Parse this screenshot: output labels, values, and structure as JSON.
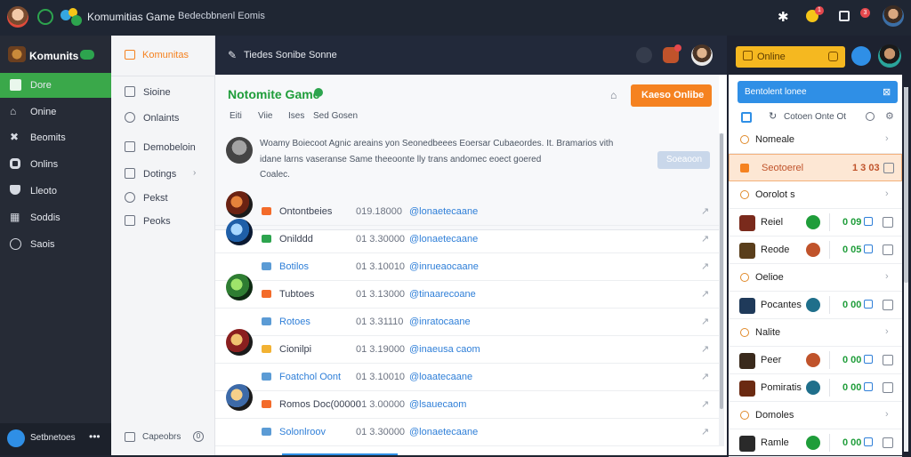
{
  "topbar": {
    "app_title": "Komumitias Game",
    "breadcrumb": "Bedecbbnenl Eomis",
    "notif_badge": "1",
    "mail_badge": "3"
  },
  "sidebar": {
    "brand": "Komunits",
    "items": [
      {
        "label": "Dore",
        "icon": "home-icon"
      },
      {
        "label": "Onine",
        "icon": "bank-icon"
      },
      {
        "label": "Beomits",
        "icon": "cross-icon"
      },
      {
        "label": "Onlins",
        "icon": "circle-icon"
      },
      {
        "label": "Lleoto",
        "icon": "shield-icon"
      },
      {
        "label": "Soddis",
        "icon": "grid-icon"
      },
      {
        "label": "Saois",
        "icon": "circle-outline-icon"
      }
    ],
    "footer_label": "Setbnetoes"
  },
  "subnav": {
    "top": "Komunitas",
    "items": [
      "Sioine",
      "Onlaints",
      "Demobeloin",
      "Dotings",
      "Pekst",
      "Peoks"
    ],
    "footer": "Capeobrs",
    "footer_badge": "0"
  },
  "main": {
    "header_title": "Tiedes Sonibe Sonne",
    "game_title": "Notomite Game",
    "tabs": [
      "Eiti",
      "Viie",
      "Ises",
      "Sed Gosen"
    ],
    "cta_label": "Kaeso Onlibe",
    "desc_line1": "Woamy Boiecoot Agnic  areains yon Seonedbeees  Eoersar Cubaeordes.  It.  Bramarios vith",
    "desc_line2": "idane larns vaseranse Same theeoonte lly trans andomec eoect goered",
    "desc_line3": "Coalec.",
    "desc_button": "Soeaoon",
    "rows": [
      {
        "name": "Ontontbeies",
        "time": "019.18000",
        "link": "@lonaetecaane",
        "tag": "#f36b2a",
        "avatar": true
      },
      {
        "name": "Onilddd",
        "time": "01 3.30000",
        "link": "@lonaetecaane",
        "tag": "#2da44e",
        "avatar": true
      },
      {
        "name": "Botilos",
        "time": "01 3.10010",
        "link": "@inrueaocaane",
        "tag": "#5b9bd5",
        "avatar": false
      },
      {
        "name": "Tubtoes",
        "time": "01 3.13000",
        "link": "@tinaarecoane",
        "tag": "#f36b2a",
        "avatar": true
      },
      {
        "name": "Rotoes",
        "time": "01 3.31110",
        "link": "@inratocaane",
        "tag": "#5b9bd5",
        "avatar": false
      },
      {
        "name": "Cionilpi",
        "time": "01 3.19000",
        "link": "@inaeusa caom",
        "tag": "#f2b233",
        "avatar": true
      },
      {
        "name": "Foatchol Oont",
        "time": "01 3.10010",
        "link": "@loaatecaane",
        "tag": "#5b9bd5",
        "avatar": false
      },
      {
        "name": "Romos Doc(00000",
        "time": "01 3.00000",
        "link": "@lsauecaom",
        "tag": "#f36b2a",
        "avatar": true
      },
      {
        "name": "Solonlroov",
        "time": "01 3.30000",
        "link": "@lonaetecaane",
        "tag": "#5b9bd5",
        "avatar": false
      }
    ]
  },
  "right": {
    "online_label": "Online",
    "search_label": "Bentolent lonee",
    "filter_label": "Cotoen Onte Ot",
    "rows": [
      {
        "type": "section",
        "label": "Nomeale"
      },
      {
        "type": "highlight",
        "label": "Seotoerel",
        "value": "1 3 03"
      },
      {
        "type": "section",
        "label": "Oorolot s"
      },
      {
        "type": "item",
        "label": "Reiel",
        "value": "0 09",
        "gem": "#1f9d3a"
      },
      {
        "type": "item",
        "label": "Reode",
        "value": "0 05",
        "gem": "#c0532b"
      },
      {
        "type": "section",
        "label": "Oelioe"
      },
      {
        "type": "item",
        "label": "Pocantes",
        "value": "0 00",
        "gem": "#1f6f8b"
      },
      {
        "type": "section",
        "label": "Nalite"
      },
      {
        "type": "item",
        "label": "Peer",
        "value": "0 00",
        "gem": "#c0532b"
      },
      {
        "type": "item",
        "label": "Pomiratis",
        "value": "0 00",
        "gem": "#1f6f8b"
      },
      {
        "type": "section",
        "label": "Domoles"
      },
      {
        "type": "item",
        "label": "Ramle",
        "value": "0 00",
        "gem": "#1f9d3a"
      }
    ]
  },
  "colors": {
    "accent_green": "#3aa84a",
    "accent_orange": "#f58220",
    "accent_blue": "#2f8fe6",
    "online_yellow": "#f5b820"
  }
}
